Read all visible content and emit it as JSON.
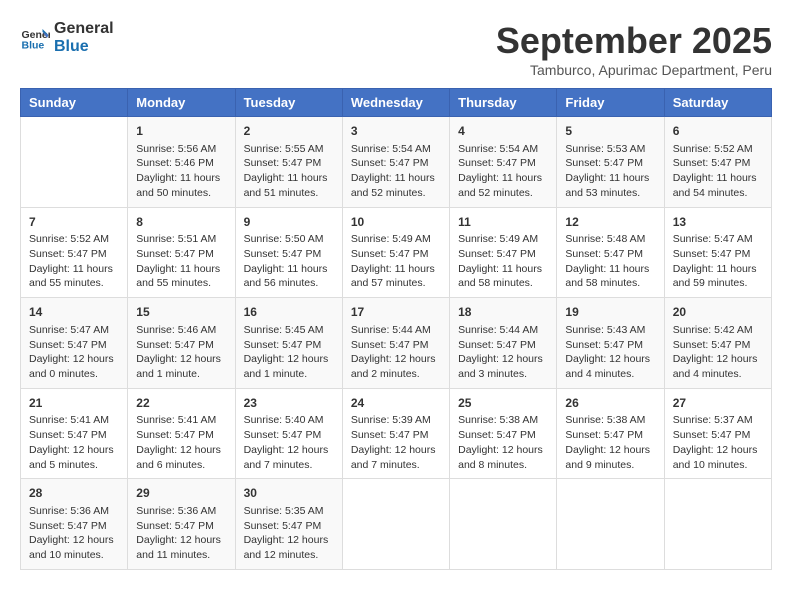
{
  "header": {
    "logo_line1": "General",
    "logo_line2": "Blue",
    "month": "September 2025",
    "location": "Tamburco, Apurimac Department, Peru"
  },
  "weekdays": [
    "Sunday",
    "Monday",
    "Tuesday",
    "Wednesday",
    "Thursday",
    "Friday",
    "Saturday"
  ],
  "weeks": [
    [
      {
        "day": "",
        "sunrise": "",
        "sunset": "",
        "daylight": ""
      },
      {
        "day": "1",
        "sunrise": "Sunrise: 5:56 AM",
        "sunset": "Sunset: 5:46 PM",
        "daylight": "Daylight: 11 hours and 50 minutes."
      },
      {
        "day": "2",
        "sunrise": "Sunrise: 5:55 AM",
        "sunset": "Sunset: 5:47 PM",
        "daylight": "Daylight: 11 hours and 51 minutes."
      },
      {
        "day": "3",
        "sunrise": "Sunrise: 5:54 AM",
        "sunset": "Sunset: 5:47 PM",
        "daylight": "Daylight: 11 hours and 52 minutes."
      },
      {
        "day": "4",
        "sunrise": "Sunrise: 5:54 AM",
        "sunset": "Sunset: 5:47 PM",
        "daylight": "Daylight: 11 hours and 52 minutes."
      },
      {
        "day": "5",
        "sunrise": "Sunrise: 5:53 AM",
        "sunset": "Sunset: 5:47 PM",
        "daylight": "Daylight: 11 hours and 53 minutes."
      },
      {
        "day": "6",
        "sunrise": "Sunrise: 5:52 AM",
        "sunset": "Sunset: 5:47 PM",
        "daylight": "Daylight: 11 hours and 54 minutes."
      }
    ],
    [
      {
        "day": "7",
        "sunrise": "Sunrise: 5:52 AM",
        "sunset": "Sunset: 5:47 PM",
        "daylight": "Daylight: 11 hours and 55 minutes."
      },
      {
        "day": "8",
        "sunrise": "Sunrise: 5:51 AM",
        "sunset": "Sunset: 5:47 PM",
        "daylight": "Daylight: 11 hours and 55 minutes."
      },
      {
        "day": "9",
        "sunrise": "Sunrise: 5:50 AM",
        "sunset": "Sunset: 5:47 PM",
        "daylight": "Daylight: 11 hours and 56 minutes."
      },
      {
        "day": "10",
        "sunrise": "Sunrise: 5:49 AM",
        "sunset": "Sunset: 5:47 PM",
        "daylight": "Daylight: 11 hours and 57 minutes."
      },
      {
        "day": "11",
        "sunrise": "Sunrise: 5:49 AM",
        "sunset": "Sunset: 5:47 PM",
        "daylight": "Daylight: 11 hours and 58 minutes."
      },
      {
        "day": "12",
        "sunrise": "Sunrise: 5:48 AM",
        "sunset": "Sunset: 5:47 PM",
        "daylight": "Daylight: 11 hours and 58 minutes."
      },
      {
        "day": "13",
        "sunrise": "Sunrise: 5:47 AM",
        "sunset": "Sunset: 5:47 PM",
        "daylight": "Daylight: 11 hours and 59 minutes."
      }
    ],
    [
      {
        "day": "14",
        "sunrise": "Sunrise: 5:47 AM",
        "sunset": "Sunset: 5:47 PM",
        "daylight": "Daylight: 12 hours and 0 minutes."
      },
      {
        "day": "15",
        "sunrise": "Sunrise: 5:46 AM",
        "sunset": "Sunset: 5:47 PM",
        "daylight": "Daylight: 12 hours and 1 minute."
      },
      {
        "day": "16",
        "sunrise": "Sunrise: 5:45 AM",
        "sunset": "Sunset: 5:47 PM",
        "daylight": "Daylight: 12 hours and 1 minute."
      },
      {
        "day": "17",
        "sunrise": "Sunrise: 5:44 AM",
        "sunset": "Sunset: 5:47 PM",
        "daylight": "Daylight: 12 hours and 2 minutes."
      },
      {
        "day": "18",
        "sunrise": "Sunrise: 5:44 AM",
        "sunset": "Sunset: 5:47 PM",
        "daylight": "Daylight: 12 hours and 3 minutes."
      },
      {
        "day": "19",
        "sunrise": "Sunrise: 5:43 AM",
        "sunset": "Sunset: 5:47 PM",
        "daylight": "Daylight: 12 hours and 4 minutes."
      },
      {
        "day": "20",
        "sunrise": "Sunrise: 5:42 AM",
        "sunset": "Sunset: 5:47 PM",
        "daylight": "Daylight: 12 hours and 4 minutes."
      }
    ],
    [
      {
        "day": "21",
        "sunrise": "Sunrise: 5:41 AM",
        "sunset": "Sunset: 5:47 PM",
        "daylight": "Daylight: 12 hours and 5 minutes."
      },
      {
        "day": "22",
        "sunrise": "Sunrise: 5:41 AM",
        "sunset": "Sunset: 5:47 PM",
        "daylight": "Daylight: 12 hours and 6 minutes."
      },
      {
        "day": "23",
        "sunrise": "Sunrise: 5:40 AM",
        "sunset": "Sunset: 5:47 PM",
        "daylight": "Daylight: 12 hours and 7 minutes."
      },
      {
        "day": "24",
        "sunrise": "Sunrise: 5:39 AM",
        "sunset": "Sunset: 5:47 PM",
        "daylight": "Daylight: 12 hours and 7 minutes."
      },
      {
        "day": "25",
        "sunrise": "Sunrise: 5:38 AM",
        "sunset": "Sunset: 5:47 PM",
        "daylight": "Daylight: 12 hours and 8 minutes."
      },
      {
        "day": "26",
        "sunrise": "Sunrise: 5:38 AM",
        "sunset": "Sunset: 5:47 PM",
        "daylight": "Daylight: 12 hours and 9 minutes."
      },
      {
        "day": "27",
        "sunrise": "Sunrise: 5:37 AM",
        "sunset": "Sunset: 5:47 PM",
        "daylight": "Daylight: 12 hours and 10 minutes."
      }
    ],
    [
      {
        "day": "28",
        "sunrise": "Sunrise: 5:36 AM",
        "sunset": "Sunset: 5:47 PM",
        "daylight": "Daylight: 12 hours and 10 minutes."
      },
      {
        "day": "29",
        "sunrise": "Sunrise: 5:36 AM",
        "sunset": "Sunset: 5:47 PM",
        "daylight": "Daylight: 12 hours and 11 minutes."
      },
      {
        "day": "30",
        "sunrise": "Sunrise: 5:35 AM",
        "sunset": "Sunset: 5:47 PM",
        "daylight": "Daylight: 12 hours and 12 minutes."
      },
      {
        "day": "",
        "sunrise": "",
        "sunset": "",
        "daylight": ""
      },
      {
        "day": "",
        "sunrise": "",
        "sunset": "",
        "daylight": ""
      },
      {
        "day": "",
        "sunrise": "",
        "sunset": "",
        "daylight": ""
      },
      {
        "day": "",
        "sunrise": "",
        "sunset": "",
        "daylight": ""
      }
    ]
  ]
}
